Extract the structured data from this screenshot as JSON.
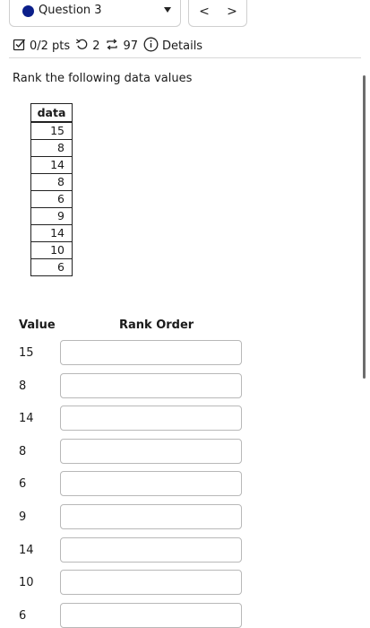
{
  "header": {
    "question_label": "Question 3",
    "prev_label": "<",
    "next_label": ">"
  },
  "meta": {
    "score": "0/2 pts",
    "retries": "2",
    "attempts": "97",
    "details_label": "Details"
  },
  "prompt": "Rank the following data values",
  "data_table": {
    "header": "data",
    "values": [
      "15",
      "8",
      "14",
      "8",
      "6",
      "9",
      "14",
      "10",
      "6"
    ]
  },
  "answer_table": {
    "value_header": "Value",
    "rank_header": "Rank Order",
    "rows": [
      {
        "value": "15",
        "answer": ""
      },
      {
        "value": "8",
        "answer": ""
      },
      {
        "value": "14",
        "answer": ""
      },
      {
        "value": "8",
        "answer": ""
      },
      {
        "value": "6",
        "answer": ""
      },
      {
        "value": "9",
        "answer": ""
      },
      {
        "value": "14",
        "answer": ""
      },
      {
        "value": "10",
        "answer": ""
      },
      {
        "value": "6",
        "answer": ""
      }
    ]
  },
  "colors": {
    "status_dot": "#0b1f8a"
  }
}
